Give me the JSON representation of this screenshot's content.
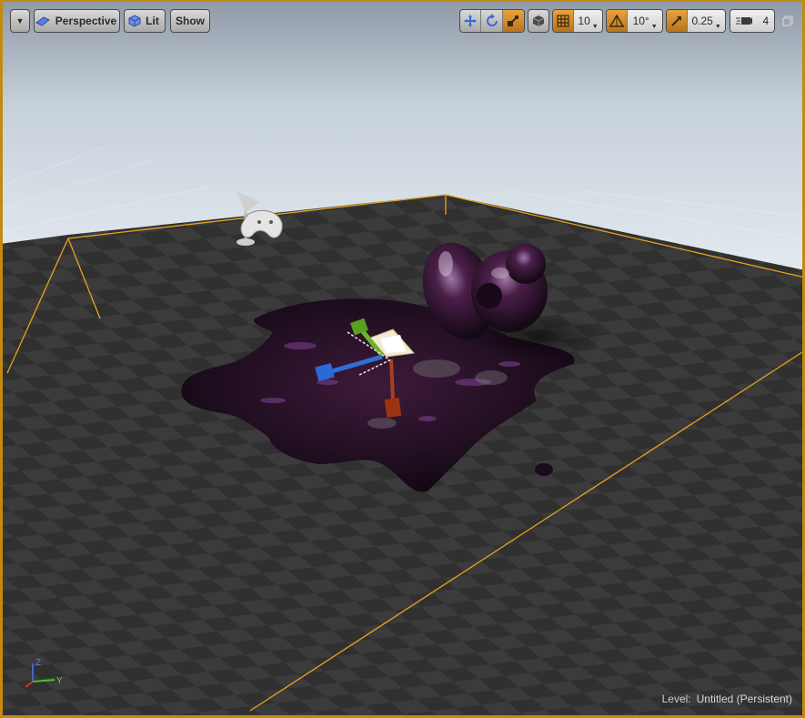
{
  "viewport": {
    "menu_icon": "chevron-down-icon",
    "view_mode": "Perspective",
    "lighting_mode": "Lit",
    "show_label": "Show"
  },
  "toolbar_right": {
    "grid_snap_value": "10",
    "rotation_snap_value": "10°",
    "scale_snap_value": "0.25",
    "camera_speed_value": "4",
    "icons": [
      "translate-icon",
      "rotate-icon",
      "scale-icon",
      "world-local-icon",
      "grid-snap-icon",
      "rotation-snap-icon",
      "scale-snap-icon",
      "camera-speed-icon",
      "maximize-icon"
    ]
  },
  "axes": {
    "z_label": "Z",
    "y_label": "Y"
  },
  "status": {
    "level_label": "Level:",
    "level_name": "Untitled (Persistent)"
  },
  "colors": {
    "selection": "#e6a21e",
    "active_tool": "#d88a24",
    "sky_top": "#9aa6b3",
    "floor": "#3a3a3a",
    "goo": "#2a0f2a"
  }
}
